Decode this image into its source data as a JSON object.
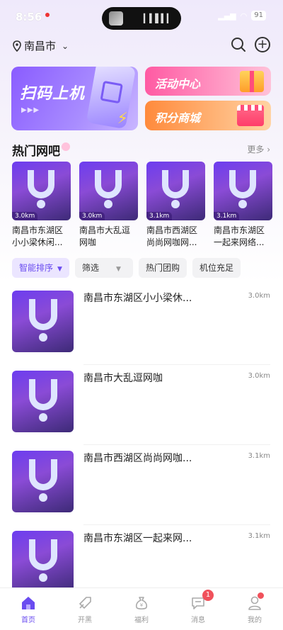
{
  "status": {
    "time": "8:56",
    "battery": "91"
  },
  "header": {
    "city": "南昌市",
    "search_icon": "search-icon",
    "add_icon": "plus-circle-icon"
  },
  "banners": {
    "scan": "扫码上机",
    "activity": "活动中心",
    "mall": "积分商城"
  },
  "hot": {
    "title": "热门网吧",
    "more": "更多 ›",
    "cards": [
      {
        "name": "南昌市东湖区小小梁休闲...",
        "dist": "3.0km"
      },
      {
        "name": "南昌市大乱逗网咖",
        "dist": "3.0km"
      },
      {
        "name": "南昌市西湖区尚尚网咖网...",
        "dist": "3.1km"
      },
      {
        "name": "南昌市东湖区一起来网络...",
        "dist": "3.1km"
      }
    ]
  },
  "filters": {
    "sort": "智能排序",
    "filter": "筛选",
    "group_buy": "热门团购",
    "seats": "机位充足"
  },
  "list": [
    {
      "name": "南昌市东湖区小小梁休...",
      "dist": "3.0km"
    },
    {
      "name": "南昌市大乱逗网咖",
      "dist": "3.0km"
    },
    {
      "name": "南昌市西湖区尚尚网咖...",
      "dist": "3.1km"
    },
    {
      "name": "南昌市东湖区一起来网...",
      "dist": "3.1km"
    }
  ],
  "tabs": [
    {
      "label": "首页",
      "icon": "home-icon"
    },
    {
      "label": "开黑",
      "icon": "rocket-icon"
    },
    {
      "label": "福利",
      "icon": "money-bag-icon"
    },
    {
      "label": "消息",
      "icon": "message-icon",
      "badge": "1"
    },
    {
      "label": "我的",
      "icon": "profile-icon"
    }
  ],
  "colors": {
    "accent": "#6a4cf0",
    "badge": "#f0515b"
  }
}
